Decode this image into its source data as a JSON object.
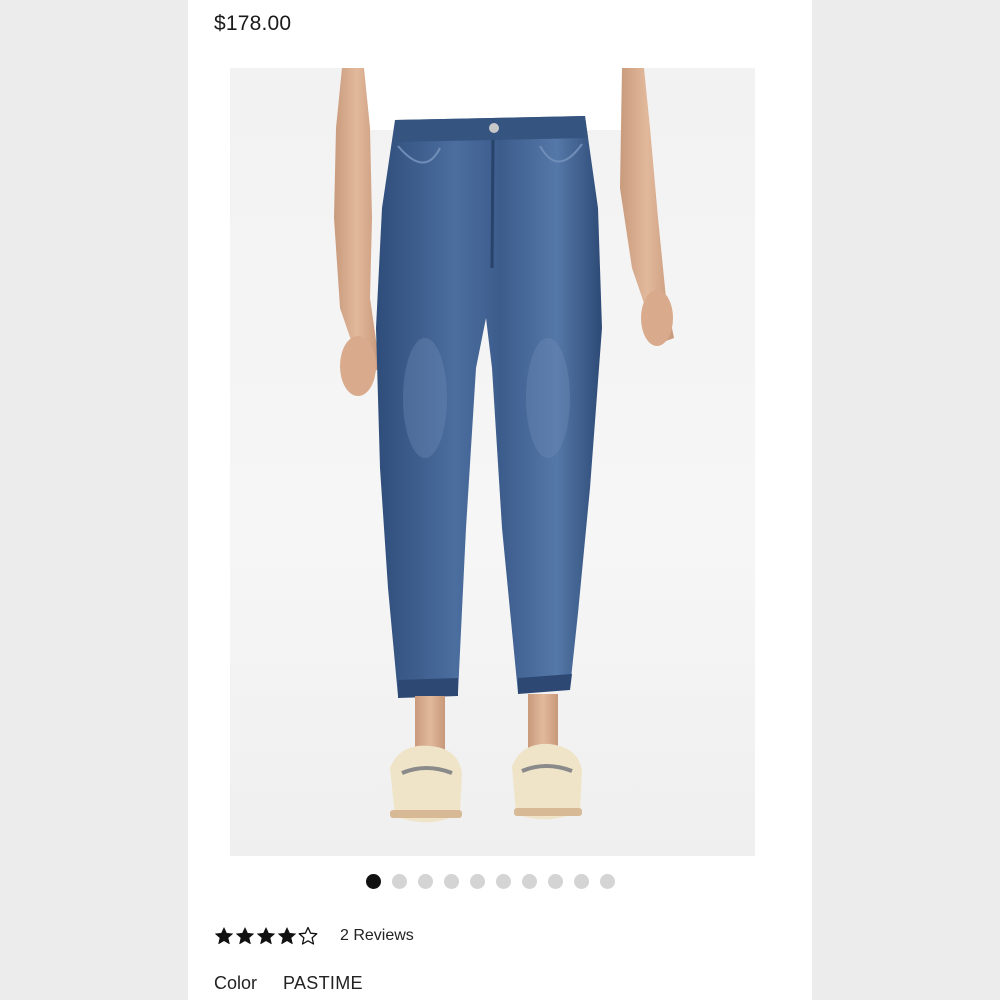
{
  "product": {
    "price": "$178.00",
    "image_alt": "model-wearing-cropped-jeans"
  },
  "carousel": {
    "count": 10,
    "active_index": 0
  },
  "rating": {
    "stars_filled": 4,
    "stars_total": 5,
    "reviews_label": "2 Reviews"
  },
  "color": {
    "label": "Color",
    "value": "PASTIME"
  },
  "colors": {
    "denim": "#3e5f8f",
    "dot_active": "#111111",
    "dot_inactive": "#d4d4d4"
  }
}
